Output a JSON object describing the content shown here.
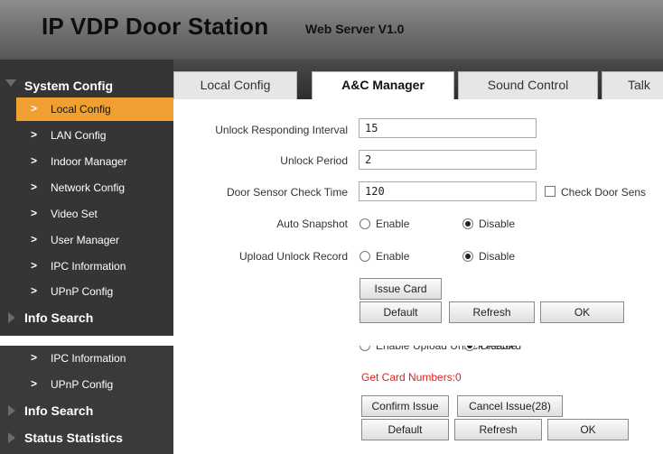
{
  "header": {
    "title": "IP VDP Door Station",
    "version": "Web Server V1.0"
  },
  "sidebar": {
    "system_config": "System Config",
    "items": [
      "Local Config",
      "LAN Config",
      "Indoor Manager",
      "Network Config",
      "Video Set",
      "User Manager",
      "IPC Information",
      "UPnP Config"
    ],
    "info_search": "Info Search",
    "status_statistics": "Status Statistics"
  },
  "tabs": [
    "Local Config",
    "A&C Manager",
    "Sound Control",
    "Talk"
  ],
  "form": {
    "unlock_interval_label": "Unlock Responding Interval",
    "unlock_interval_value": "15",
    "unlock_period_label": "Unlock Period",
    "unlock_period_value": "2",
    "door_sensor_label": "Door Sensor Check Time",
    "door_sensor_value": "120",
    "check_door_sensor_label": "Check Door Sens",
    "auto_snapshot_label": "Auto Snapshot",
    "upload_unlock_label": "Upload Unlock Record",
    "enable": "Enable",
    "disable": "Disable",
    "auto_snapshot_selected": "Disable",
    "upload_unlock_selected": "Disable"
  },
  "buttons": {
    "issue_card": "Issue Card",
    "default": "Default",
    "refresh": "Refresh",
    "ok": "OK",
    "confirm_issue": "Confirm Issue",
    "cancel_issue": "Cancel Issue(28)"
  },
  "card_status": "Get Card Numbers:0"
}
